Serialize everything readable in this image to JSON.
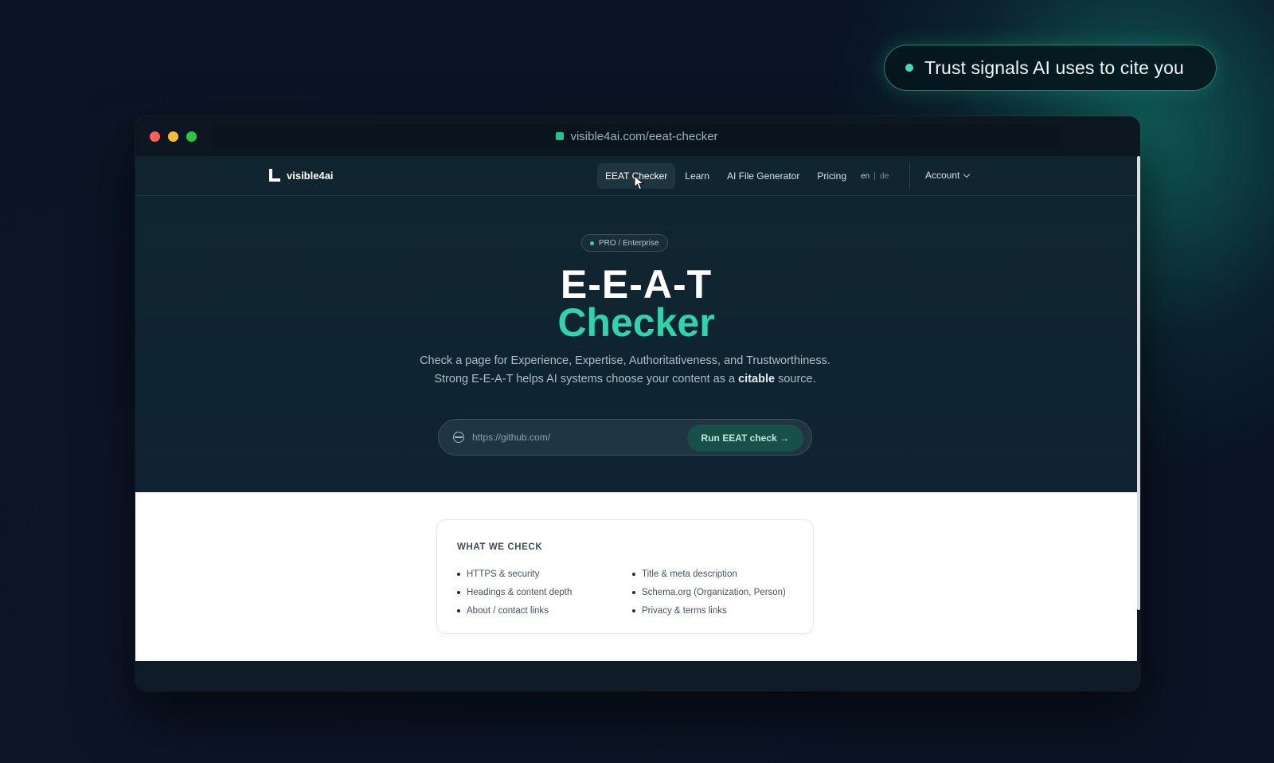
{
  "callout": {
    "text": "Trust signals AI uses to cite you"
  },
  "browser": {
    "url": "visible4ai.com/eeat-checker"
  },
  "site": {
    "brand": "visible4ai",
    "nav": [
      {
        "label": "EEAT Checker",
        "active": true
      },
      {
        "label": "Learn"
      },
      {
        "label": "AI File Generator"
      },
      {
        "label": "Pricing"
      }
    ],
    "lang": {
      "current": "en",
      "other": "de"
    },
    "account_label": "Account"
  },
  "hero": {
    "badge": "PRO / Enterprise",
    "title_line1": "E-E-A-T",
    "title_line2": "Checker",
    "desc_part1": "Check a page for Experience, Expertise, Authoritativeness, and Trustworthiness. Strong E-E-A-T helps AI systems choose your content as a ",
    "desc_bold": "citable",
    "desc_part2": " source.",
    "input_value": "https://github.com/",
    "button_label": "Run EEAT check →"
  },
  "checks": {
    "title": "WHAT WE CHECK",
    "left": [
      "HTTPS & security",
      "Headings & content depth",
      "About / contact links"
    ],
    "right": [
      "Title & meta description",
      "Schema.org (Organization, Person)",
      "Privacy & terms links"
    ]
  },
  "colors": {
    "accent": "#2dd4ad",
    "bg": "#0b1626",
    "hero": "#0f2530"
  }
}
